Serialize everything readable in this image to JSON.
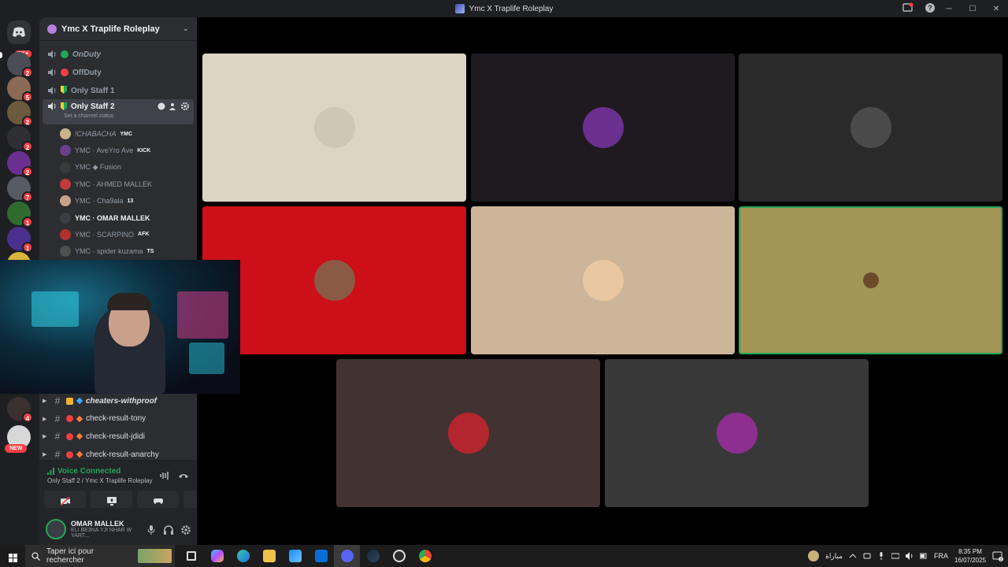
{
  "window": {
    "title": "Ymc X Traplife Roleplay",
    "controls": [
      "─",
      "☐",
      "✕"
    ]
  },
  "rail": {
    "dm_badge": "1K+",
    "servers": [
      {
        "badge": "2",
        "color": "#4a4d55"
      },
      {
        "badge": "5",
        "color": "#8a6a55"
      },
      {
        "badge": "2",
        "color": "#6b5a3e"
      },
      {
        "badge": "2",
        "color": "#2f2f33"
      },
      {
        "badge": "2",
        "color": "#6b2f8f"
      },
      {
        "badge": "7",
        "color": "#555a63"
      },
      {
        "badge": "1",
        "color": "#2f6b2f"
      },
      {
        "badge": "1",
        "color": "#4a2f8f"
      },
      {
        "badge": "",
        "color": "#d9b53a"
      }
    ],
    "lower_servers": [
      {
        "badge": "4",
        "color": "#3a3030"
      },
      {
        "badge": "",
        "color": "#d8d8d8"
      }
    ],
    "new_badge": "NEW"
  },
  "server": {
    "name": "Ymc X Traplife Roleplay"
  },
  "voice_channels": [
    {
      "name": "OnDuty",
      "dot": "#23a55a"
    },
    {
      "name": "OffDuty",
      "dot": "#f23f43"
    },
    {
      "name": "Only Staff 1",
      "dot": ""
    },
    {
      "name": "Only Staff 2",
      "dot": "",
      "status": "Set a channel status"
    }
  ],
  "members": [
    {
      "name": "!CHABACHA",
      "tag": "YMC",
      "color": "#c8b38a"
    },
    {
      "name": "YMC · AveYro Ave",
      "tag": "KICK",
      "color": "#6a3e8a"
    },
    {
      "name": "YMC ◆ Fusion",
      "tag": "",
      "color": "#3a3a3a"
    },
    {
      "name": "YMC · AHMED MALLEK",
      "tag": "",
      "color": "#c23a3a"
    },
    {
      "name": "YMC · Cha9ala",
      "tag": "13",
      "color": "#c9a08a"
    },
    {
      "name": "YMC · OMAR MALLEK",
      "tag": "",
      "color": "#3a3d44"
    },
    {
      "name": "YMC · SCARPINO",
      "tag": "AFK",
      "color": "#b03030"
    },
    {
      "name": "YMC · spider kuzama",
      "tag": "TS",
      "color": "#505050"
    }
  ],
  "text_channels": [
    {
      "name": "cheaters-withproof",
      "icon": "lock"
    },
    {
      "name": "check-result-tony",
      "icon": "no-entry"
    },
    {
      "name": "check-result-jdidi",
      "icon": "no-entry"
    },
    {
      "name": "check-result-anarchy",
      "icon": "no-entry"
    }
  ],
  "voice_panel": {
    "status": "Voice Connected",
    "location": "Only Staff 2 / Ymc X Traplife Roleplay"
  },
  "user": {
    "name": "OMAR MALLEK",
    "status": "ELI BE3NA YJI NHAR W YART..."
  },
  "tiles": [
    {
      "bg": "#ddd5c4",
      "av": "#cfc7b5",
      "speaking": false
    },
    {
      "bg": "#1e1a1f",
      "av": "#6b2f8f",
      "speaking": false
    },
    {
      "bg": "#2a2a2a",
      "av": "#4a4a4a",
      "speaking": false
    },
    {
      "bg": "#cc0f18",
      "av": "#8a5a45",
      "speaking": false
    },
    {
      "bg": "#cdb599",
      "av": "#e9c7a0",
      "speaking": false
    },
    {
      "bg": "#a29556",
      "av": "#a29556",
      "speaking": true
    },
    {
      "bg": "#433232",
      "av": "#b3262f",
      "speaking": false
    },
    {
      "bg": "#383838",
      "av": "#8c2f8f",
      "speaking": false
    }
  ],
  "taskbar": {
    "search_placeholder": "Taper ici pour rechercher",
    "weather": "مباراة",
    "lang": "FRA",
    "time": "8:35 PM",
    "date": "16/07/2025",
    "notif_count": "3"
  }
}
